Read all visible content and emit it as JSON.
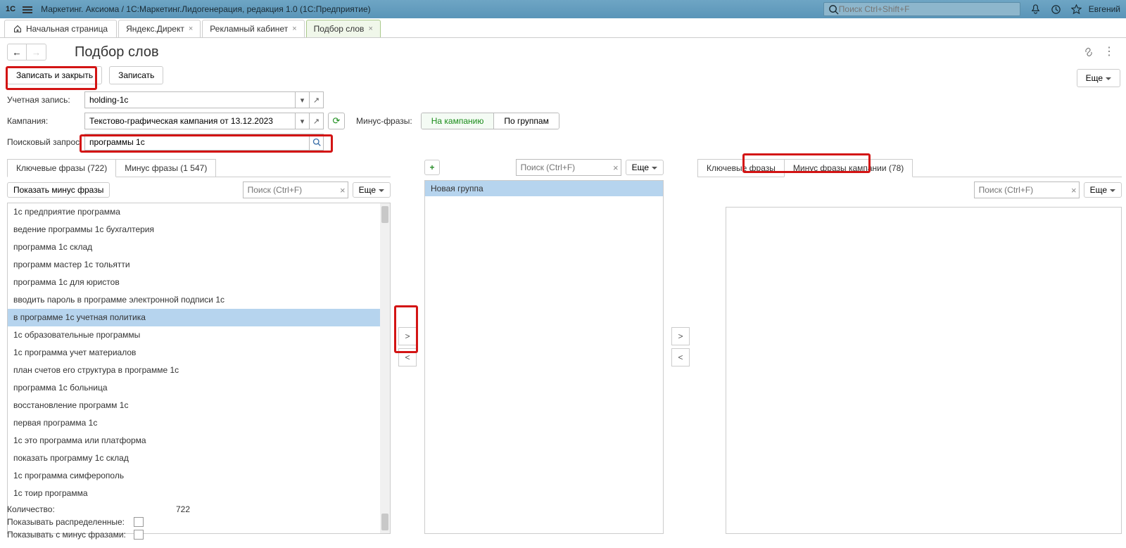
{
  "titlebar": {
    "logo": "1C",
    "title": "Маркетинг. Аксиома / 1С:Маркетинг.Лидогенерация, редакция 1.0  (1С:Предприятие)",
    "search_placeholder": "Поиск Ctrl+Shift+F",
    "user": "Евгений"
  },
  "tabs": {
    "home": "Начальная страница",
    "items": [
      {
        "label": "Яндекс.Директ",
        "active": false
      },
      {
        "label": "Рекламный кабинет",
        "active": false
      },
      {
        "label": "Подбор слов",
        "active": true
      }
    ]
  },
  "page": {
    "title": "Подбор слов"
  },
  "cmd": {
    "save_close": "Записать и закрыть",
    "save": "Записать",
    "more": "Еще"
  },
  "form": {
    "account_label": "Учетная запись:",
    "account_value": "holding-1c",
    "campaign_label": "Кампания:",
    "campaign_value": "Текстово-графическая кампания от 13.12.2023",
    "minus_label": "Минус-фразы:",
    "minus_on_campaign": "На кампанию",
    "minus_by_groups": "По группам",
    "query_label": "Поисковый запрос:",
    "query_value": "программы 1с"
  },
  "left": {
    "tab_keys": "Ключевые фразы (722)",
    "tab_minus": "Минус фразы (1 547)",
    "show_minus_btn": "Показать минус фразы",
    "search_placeholder": "Поиск (Ctrl+F)",
    "more": "Еще",
    "rows": [
      "1с предприятие программа",
      "ведение программы 1с бухгалтерия",
      "программа 1с склад",
      "программ мастер 1с тольятти",
      "программа 1с для юристов",
      "вводить пароль в программе электронной подписи 1с",
      "в программе 1с учетная политика",
      "1с образовательные программы",
      "1с программа учет материалов",
      "план счетов его структура в программе 1с",
      "программа 1с больница",
      "восстановление программ 1с",
      "первая программа 1с",
      "1с это программа или платформа",
      "показать программу 1с склад",
      "1с программа симферополь",
      "1с тоир программа"
    ],
    "selected_index": 6
  },
  "center": {
    "search_placeholder": "Поиск (Ctrl+F)",
    "more": "Еще",
    "group": "Новая группа"
  },
  "right": {
    "tab_keys": "Ключевые фразы",
    "tab_minus": "Минус фразы кампании (78)",
    "search_placeholder": "Поиск (Ctrl+F)",
    "more": "Еще"
  },
  "footer": {
    "count_label": "Количество:",
    "count_value": "722",
    "show_assigned_label": "Показывать распределенные:",
    "show_with_minus_label": "Показывать с минус фразами:"
  }
}
